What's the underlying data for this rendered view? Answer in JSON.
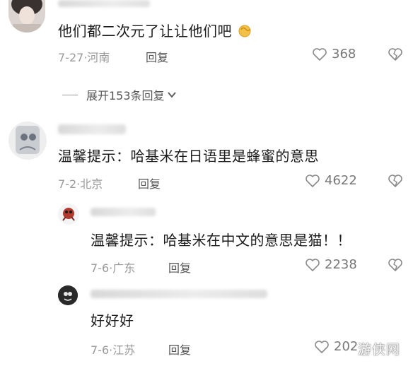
{
  "comments": [
    {
      "text": "他们都二次元了让让他们吧",
      "emoji": "✊",
      "date": "7-27",
      "location": "河南",
      "reply": "回复",
      "likes": "368"
    },
    {
      "text": "温馨提示：哈基米在日语里是蜂蜜的意思",
      "date": "7-2",
      "location": "北京",
      "reply": "回复",
      "likes": "4622"
    },
    {
      "text": "温馨提示：哈基米在中文的意思是猫！！",
      "date": "7-6",
      "location": "广东",
      "reply": "回复",
      "likes": "2238"
    },
    {
      "text": "好好好",
      "date": "7-6",
      "location": "江苏",
      "reply": "回复",
      "likes": "202"
    }
  ],
  "expand": {
    "label": "展开153条回复"
  },
  "meta_sep": "·",
  "watermark": "游侠网",
  "colors": {
    "meta": "#9a9a9a",
    "text": "#1c1c1c",
    "bg": "#ffffff"
  },
  "icons": {
    "like": "heart-outline-icon",
    "dislike": "broken-heart-icon",
    "expand": "chevron-down-icon"
  }
}
